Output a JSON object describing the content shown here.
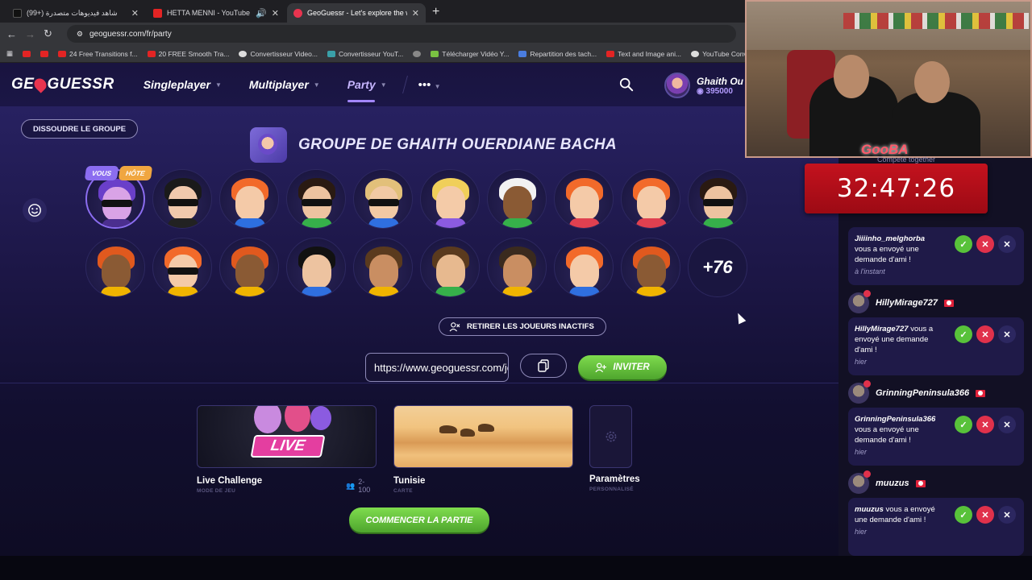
{
  "browser": {
    "tabs": [
      {
        "title": "شاهد فيديوهات متصدرة (+99)",
        "favicon_color": "#111111"
      },
      {
        "title": "HETTA MENNI - YouTube",
        "favicon_color": "#e32424"
      },
      {
        "title": "GeoGuessr - Let's explore the w",
        "favicon_color": "#e8344f"
      }
    ],
    "url": "geoguessr.com/fr/party",
    "bookmarks": [
      {
        "label": "24 Free Transitions f..."
      },
      {
        "label": "20 FREE Smooth Tra..."
      },
      {
        "label": "Convertisseur Video..."
      },
      {
        "label": "Convertisseur YouT..."
      },
      {
        "label": "Télécharger Vidéo Y..."
      },
      {
        "label": "Repartition des tach..."
      },
      {
        "label": "Text and Image ani..."
      },
      {
        "label": "YouTube Converter..."
      }
    ]
  },
  "nav": {
    "logo_left": "GE",
    "logo_right": "GUESSR",
    "singleplayer": "Singleplayer",
    "multiplayer": "Multiplayer",
    "party": "Party",
    "more": "•••",
    "profile_name": "Ghaith Ou",
    "profile_coins": "395000"
  },
  "party": {
    "dissolve_label": "DISSOUDRE LE GROUPE",
    "title": "GROUPE DE GHAITH OUERDIANE BACHA",
    "badge_you": "VOUS",
    "badge_host": "HÔTE",
    "more_players": "+76",
    "remove_inactive": "RETIRER LES JOUEURS INACTIFS",
    "invite_link": "https://www.geoguessr.com/join/",
    "invite_label": "INVITER",
    "start_label": "COMMENCER LA PARTIE"
  },
  "cards": {
    "live_tag": "LIVE",
    "live_title": "Live Challenge",
    "live_sub": "MODE DE JEU",
    "live_players": "2-100",
    "map_title": "Tunisie",
    "map_sub": "CARTE",
    "settings_title": "Paramètres",
    "settings_sub": "PERSONNALISÉ"
  },
  "stream": {
    "brand": "GooBA",
    "compete": "Compete together",
    "timer": "32:47:26"
  },
  "notifications": [
    {
      "name": "Jiiiinho_melghorba",
      "message": "vous a envoyé une demande d'ami !",
      "time": "à l'instant"
    },
    {
      "name": "HillyMirage727",
      "message": "vous a envoyé une demande d'ami !",
      "time": "hier"
    },
    {
      "name": "GrinningPeninsula366",
      "message": "vous a envoyé une demande d'ami !",
      "time": "hier"
    },
    {
      "name": "muuzus",
      "message": "vous a envoyé une demande d'ami !",
      "time": "hier"
    }
  ]
}
